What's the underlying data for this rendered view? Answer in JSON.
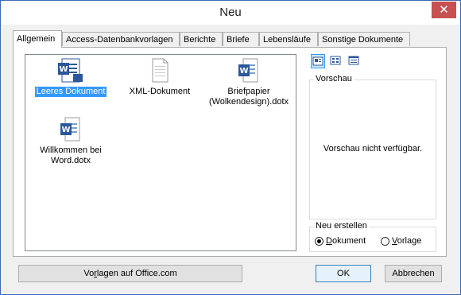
{
  "window": {
    "title": "Neu",
    "close_glyph": "✕"
  },
  "tabs": [
    {
      "label": "Allgemein",
      "active": true
    },
    {
      "label": "Access-Datenbankvorlagen",
      "active": false
    },
    {
      "label": "Berichte",
      "active": false
    },
    {
      "label": "Briefe",
      "active": false
    },
    {
      "label": "Lebensläufe",
      "active": false
    },
    {
      "label": "Sonstige Dokumente",
      "active": false
    }
  ],
  "templates": [
    {
      "label": "Leeres Dokument",
      "icon": "word-blank-document-icon",
      "selected": true
    },
    {
      "label": "XML-Dokument",
      "icon": "xml-document-icon",
      "selected": false
    },
    {
      "label_line1": "Briefpapier",
      "label_line2": "(Wolkendesign).dotx",
      "icon": "word-template-icon",
      "selected": false
    },
    {
      "label_line1": "Willkommen bei",
      "label_line2": "Word.dotx",
      "icon": "word-template-icon",
      "selected": false
    }
  ],
  "view_buttons": [
    "large-icons-view-icon",
    "list-view-icon",
    "details-view-icon"
  ],
  "preview": {
    "legend": "Vorschau",
    "message": "Vorschau nicht verfügbar."
  },
  "create_new": {
    "legend": "Neu erstellen",
    "options": [
      {
        "accel": "D",
        "rest": "okument",
        "checked": true
      },
      {
        "accel": "V",
        "rest": "orlage",
        "checked": false
      }
    ]
  },
  "buttons": {
    "office_pre": "Vo",
    "office_accel": "r",
    "office_post": "lagen auf Office.com",
    "ok": "OK",
    "cancel": "Abbrechen"
  },
  "colors": {
    "accent": "#3399ff",
    "word_blue": "#2b579a",
    "close_red": "#c75050"
  }
}
